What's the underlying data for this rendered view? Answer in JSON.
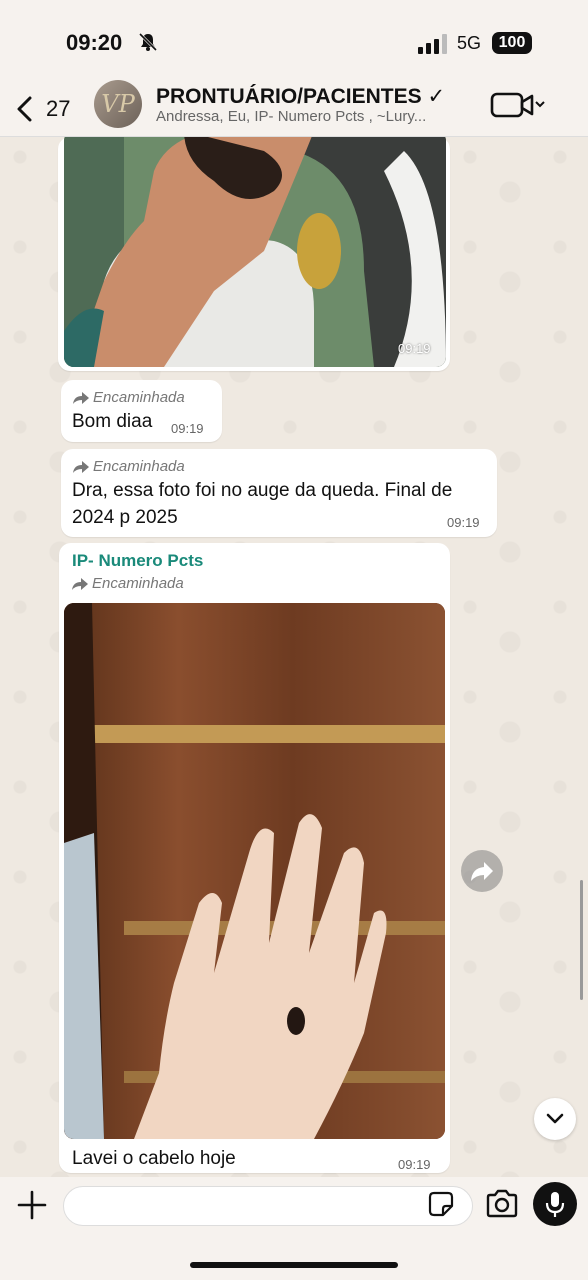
{
  "status_bar": {
    "time": "09:20",
    "network": "5G",
    "battery": "100"
  },
  "header": {
    "back_count": "27",
    "title": "PRONTUÁRIO/PACIENTES",
    "title_mark": "✓",
    "subtitle": "Andressa, Eu, IP- Numero Pcts , ~Lury...",
    "avatar_initials": "VP"
  },
  "messages": [
    {
      "type": "image",
      "time": "09:19"
    },
    {
      "type": "text",
      "forwarded_label": "Encaminhada",
      "text": "Bom diaa",
      "time": "09:19"
    },
    {
      "type": "text",
      "forwarded_label": "Encaminhada",
      "text": "Dra, essa foto foi no auge da queda. Final de 2024 p 2025",
      "time": "09:19"
    },
    {
      "type": "image",
      "sender": "IP- Numero Pcts",
      "forwarded_label": "Encaminhada",
      "caption": "Lavei o cabelo hoje",
      "time": "09:19"
    }
  ],
  "composer": {
    "placeholder": ""
  },
  "icons": {
    "bell": "bell-slash-icon",
    "back": "chevron-left-icon",
    "video": "video-camera-icon",
    "forward": "forward-arrow-icon",
    "scroll_down": "chevron-down-icon",
    "plus": "plus-icon",
    "sticker": "sticker-icon",
    "camera": "camera-icon",
    "mic": "microphone-icon"
  },
  "colors": {
    "sender_name": "#1a8a7a",
    "chat_bg": "#efe9e1",
    "bubble_bg": "#ffffff"
  }
}
